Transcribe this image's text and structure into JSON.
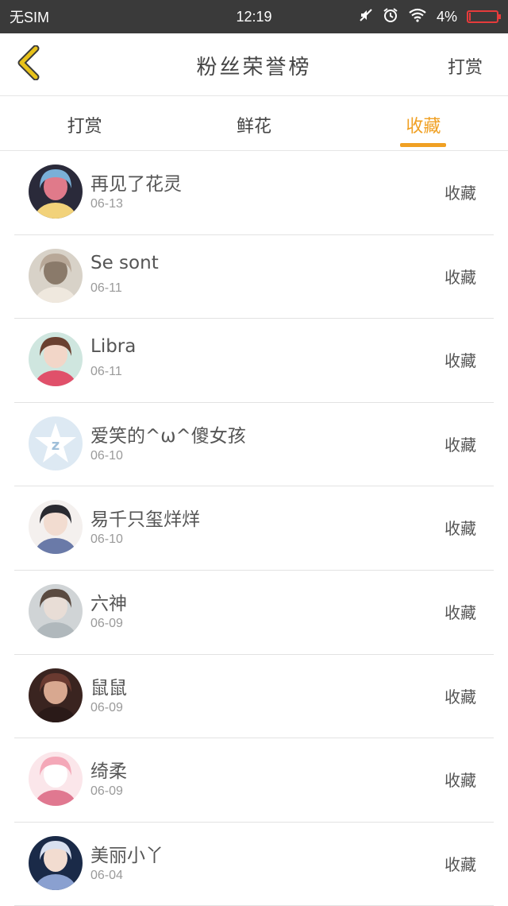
{
  "status_bar": {
    "carrier": "无SIM",
    "time": "12:19",
    "battery": "4%",
    "battery_level": 0.04,
    "icons": [
      "mute-icon",
      "alarm-icon",
      "wifi-icon",
      "battery-icon"
    ]
  },
  "header": {
    "back_icon": "chevron-left-icon",
    "title": "粉丝荣誉榜",
    "action_label": "打赏"
  },
  "tabs": [
    {
      "label": "打赏",
      "active": false
    },
    {
      "label": "鲜花",
      "active": false
    },
    {
      "label": "收藏",
      "active": true
    }
  ],
  "colors": {
    "accent": "#f0a023",
    "status_bar": "#3a3a3a",
    "back_icon": "#e8b21a"
  },
  "fans": [
    {
      "name": "再见了花灵",
      "date": "06-13",
      "action": "收藏"
    },
    {
      "name": "Se sont",
      "date": "06-11",
      "action": "收藏"
    },
    {
      "name": "Libra",
      "date": "06-11",
      "action": "收藏"
    },
    {
      "name": "爱笑的^ω^傻女孩",
      "date": "06-10",
      "action": "收藏"
    },
    {
      "name": "易千只玺烊烊",
      "date": "06-10",
      "action": "收藏"
    },
    {
      "name": "六神",
      "date": "06-09",
      "action": "收藏"
    },
    {
      "name": "鼠鼠",
      "date": "06-09",
      "action": "收藏"
    },
    {
      "name": "绮柔",
      "date": "06-09",
      "action": "收藏"
    },
    {
      "name": "美丽小丫",
      "date": "06-04",
      "action": "收藏"
    }
  ]
}
